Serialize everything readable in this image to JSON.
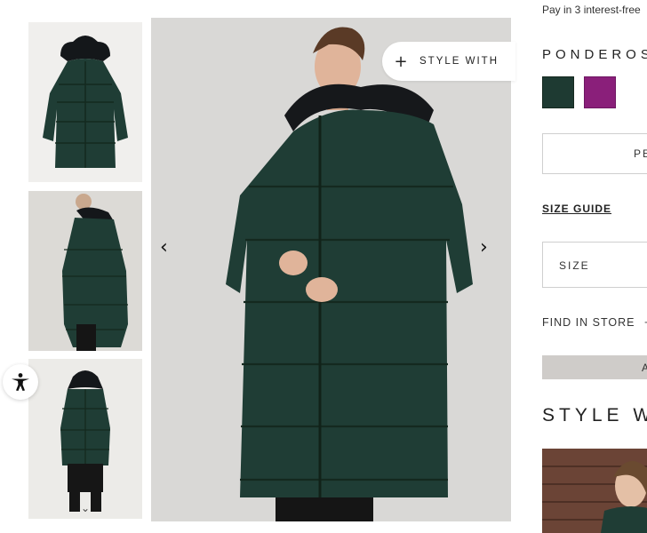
{
  "payment": {
    "text": "Pay in 3 interest-free"
  },
  "gallery": {
    "style_with_label": "STYLE WITH",
    "style_with_plus": "+",
    "prev_label": "‹",
    "next_label": "›",
    "thumb_scroll_icon": "chevron-down-icon",
    "main_coat_color": "#1f3d35"
  },
  "product": {
    "color_name": "PONDEROS",
    "swatches": [
      {
        "name": "green",
        "color": "#1e3a32"
      },
      {
        "name": "purple",
        "color": "#8a1f7a"
      }
    ],
    "fit_option_label": "PE",
    "size_guide_label": "SIZE GUIDE",
    "size_placeholder": "SIZE",
    "find_in_store_label": "FIND IN STORE",
    "find_in_store_suffix": "+",
    "add_button_label": "A"
  },
  "style_with": {
    "heading": "STYLE W"
  }
}
